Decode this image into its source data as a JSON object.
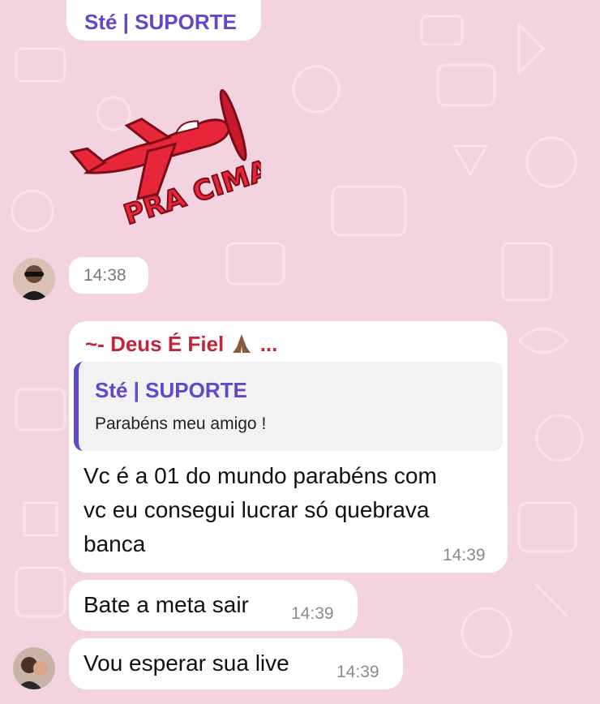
{
  "colors": {
    "background": "#f3d3e0",
    "sender_purple": "#6447c9",
    "sender_red": "#c0263b",
    "quote_bar": "#6447c9"
  },
  "message1": {
    "sender": "Sté | SUPORTE",
    "time": "14:38"
  },
  "sticker": {
    "text": "PRA CIMA",
    "icon": "airplane-sticker-icon"
  },
  "message2": {
    "sender": "~- Deus É Fiel",
    "sender_suffix": "...",
    "sender_emoji": "praying-hands-icon",
    "reply": {
      "sender": "Sté | SUPORTE",
      "text": "Parabéns meu amigo !"
    },
    "text_lines": [
      "Vc é a 01 do mundo parabéns com",
      "vc eu consegui lucrar só quebrava",
      "banca"
    ],
    "time": "14:39"
  },
  "message3": {
    "text": "Bate a meta sair",
    "time": "14:39"
  },
  "message4": {
    "text": "Vou esperar sua live",
    "time": "14:39"
  }
}
